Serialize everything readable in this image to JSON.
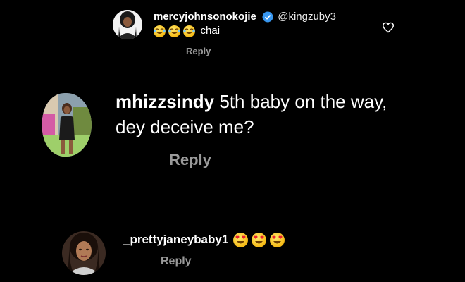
{
  "comments": [
    {
      "username": "mercyjohnsonokojie",
      "mention": "@kingzuby3",
      "text": "chai",
      "emojis": [
        "laughing-emoji",
        "laughing-emoji",
        "laughing-emoji"
      ],
      "reply_label": "Reply"
    },
    {
      "username": "mhizzsindy",
      "text": "5th baby on the way,",
      "text_line2": "dey deceive me?",
      "reply_label": "Reply"
    },
    {
      "username": "_prettyjaneybaby1",
      "emojis": [
        "heart-eyes-emoji",
        "heart-eyes-emoji",
        "heart-eyes-emoji"
      ],
      "reply_label": "Reply"
    }
  ],
  "icons": {
    "like": "heart-outline-icon",
    "verified": "verified-badge-icon"
  },
  "colors": {
    "background": "#000000",
    "text": "#ffffff",
    "reply": "#9a9a9a",
    "verified": "#3897f0"
  }
}
